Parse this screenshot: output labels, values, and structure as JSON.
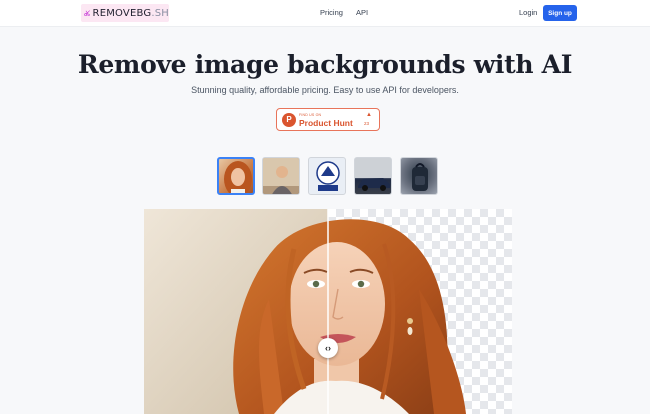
{
  "nav": {
    "logo_main": "REMOVEBG",
    "logo_ext": ".SH",
    "pricing_label": "Pricing",
    "api_label": "API",
    "login_label": "Login",
    "signup_label": "Sign up"
  },
  "hero": {
    "title": "Remove image backgrounds with AI",
    "subtitle": "Stunning quality, affordable pricing. Easy to use API for developers."
  },
  "product_hunt": {
    "small_label": "FIND US ON",
    "name": "Product Hunt",
    "letter": "P",
    "arrow": "▲",
    "count": "23"
  },
  "samples": [
    {
      "icon": "portrait-red-hair",
      "selected": true
    },
    {
      "icon": "man-in-office",
      "selected": false
    },
    {
      "icon": "logo-graphic",
      "selected": false
    },
    {
      "icon": "car-photo",
      "selected": false
    },
    {
      "icon": "backpack-photo",
      "selected": false
    }
  ],
  "comparison": {
    "handle_glyph": "‹›",
    "split_fraction": 0.5
  },
  "colors": {
    "accent": "#2563eb",
    "product_hunt": "#da552f",
    "logo_bg": "#fce7f3",
    "background": "#f7f8fa"
  }
}
